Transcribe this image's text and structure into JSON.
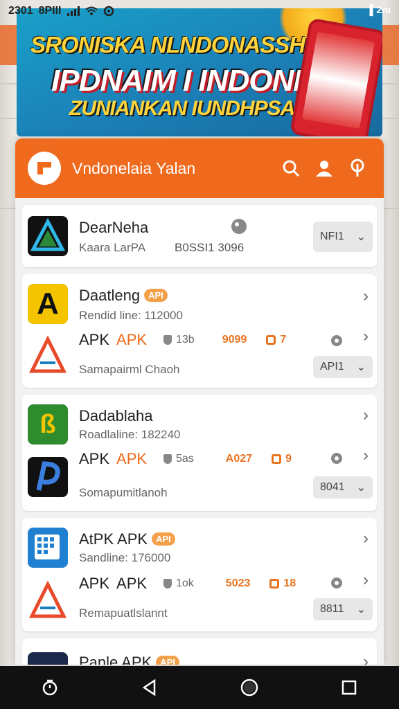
{
  "status_bar": {
    "time_text": "2301",
    "network": "8PIII",
    "right_text": "▌2лı"
  },
  "banner": {
    "line1": "SRONISKA NLNDONASSH",
    "line2": "IPDNAIM I INDONFSA!",
    "line3": "ZUNIANKAN IUNDHPSAN"
  },
  "app": {
    "title": "Vndonelaia Yalan",
    "icons": [
      "search-icon",
      "person-icon",
      "info-icon"
    ],
    "accent": "#ef6a1c"
  },
  "items": [
    {
      "title": "DearNeha",
      "subtitle": "Kaara LarPA",
      "code": "B0SSI1 3096",
      "dropdown": "NFI1"
    },
    {
      "title": "Daatleng",
      "badge": "API",
      "subtitle": "Rendid line: 112000",
      "apk_label": "APK",
      "apk_orange": "APK",
      "stat1": "13b",
      "stat2": "9099",
      "stat3": "7",
      "caption": "Samapairml Chaoh",
      "dropdown": "API1"
    },
    {
      "title": "Dadablaha",
      "subtitle": "Roadlaline: 182240",
      "apk_label": "APK",
      "apk_orange": "APK",
      "stat1": "5as",
      "stat2": "A027",
      "stat3": "9",
      "caption": "Somapumitlanoh",
      "dropdown": "8041"
    },
    {
      "title": "AtPK APK",
      "badge": "API",
      "subtitle": "Sandline: 176000",
      "apk_label": "APK",
      "apk_orange": "APK",
      "stat1": "1ok",
      "stat2": "5023",
      "stat3": "18",
      "caption": "Remapuatlslannt",
      "dropdown": "8811"
    },
    {
      "title": "Panle APK",
      "badge": "API"
    }
  ]
}
